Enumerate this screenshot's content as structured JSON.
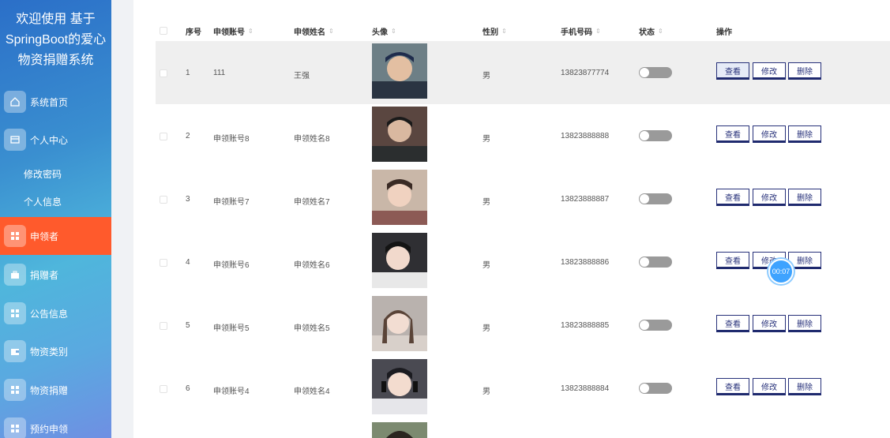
{
  "app": {
    "title": "欢迎使用 基于SpringBoot的爱心物资捐赠系统"
  },
  "sidebar": {
    "title_lines": [
      "欢迎使用 基于",
      "SpringBoot的爱心",
      "物资捐赠系统"
    ],
    "items": [
      {
        "label": "系统首页",
        "icon": "home-icon"
      },
      {
        "label": "个人中心",
        "icon": "card-icon"
      },
      {
        "label": "修改密码"
      },
      {
        "label": "个人信息"
      },
      {
        "label": "申领者",
        "icon": "grid-icon",
        "active": true
      },
      {
        "label": "捐赠者",
        "icon": "briefcase-icon"
      },
      {
        "label": "公告信息",
        "icon": "grid-icon"
      },
      {
        "label": "物资类别",
        "icon": "wallet-icon"
      },
      {
        "label": "物资捐赠",
        "icon": "grid-icon"
      },
      {
        "label": "预约申领",
        "icon": "grid-icon"
      }
    ],
    "colors": {
      "active": "#ff5a2c"
    }
  },
  "table": {
    "headers": [
      "序号",
      "申领账号",
      "申领姓名",
      "头像",
      "性别",
      "手机号码",
      "状态",
      "操作"
    ],
    "rows": [
      {
        "index": "1",
        "account": "111",
        "name": "王强",
        "gender": "男",
        "phone": "13823877774",
        "status_on": false
      },
      {
        "index": "2",
        "account": "申领账号8",
        "name": "申领姓名8",
        "gender": "男",
        "phone": "13823888888",
        "status_on": false
      },
      {
        "index": "3",
        "account": "申领账号7",
        "name": "申领姓名7",
        "gender": "男",
        "phone": "13823888887",
        "status_on": false
      },
      {
        "index": "4",
        "account": "申领账号6",
        "name": "申领姓名6",
        "gender": "男",
        "phone": "13823888886",
        "status_on": false
      },
      {
        "index": "5",
        "account": "申领账号5",
        "name": "申领姓名5",
        "gender": "男",
        "phone": "13823888885",
        "status_on": false
      },
      {
        "index": "6",
        "account": "申领账号4",
        "name": "申领姓名4",
        "gender": "男",
        "phone": "13823888884",
        "status_on": false
      }
    ],
    "actions": {
      "view": "查看",
      "edit": "修改",
      "delete": "删除"
    }
  },
  "timer": {
    "label": "00:07"
  }
}
